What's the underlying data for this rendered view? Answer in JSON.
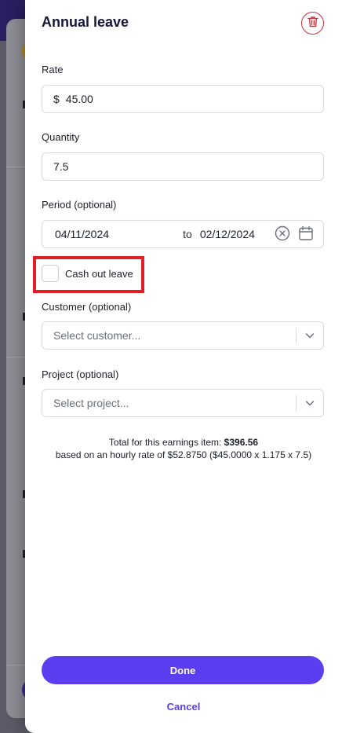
{
  "modal": {
    "title": "Annual leave",
    "rate": {
      "label": "Rate",
      "currency": "$",
      "value": "45.00"
    },
    "quantity": {
      "label": "Quantity",
      "value": "7.5"
    },
    "period": {
      "label": "Period (optional)",
      "start": "04/11/2024",
      "separator": "to",
      "end": "02/12/2024"
    },
    "cash_out": {
      "label": "Cash out leave",
      "checked": false
    },
    "customer": {
      "label": "Customer (optional)",
      "placeholder": "Select customer..."
    },
    "project": {
      "label": "Project (optional)",
      "placeholder": "Select project..."
    },
    "total": {
      "prefix": "Total for this earnings item:",
      "amount": "$396.56",
      "detail": "based on an hourly rate of $52.8750 ($45.0000 x 1.175 x 7.5)"
    },
    "done_label": "Done",
    "cancel_label": "Cancel"
  },
  "colors": {
    "accent": "#5b3ef0",
    "danger": "#d0313c",
    "highlight": "#e31e2b"
  }
}
